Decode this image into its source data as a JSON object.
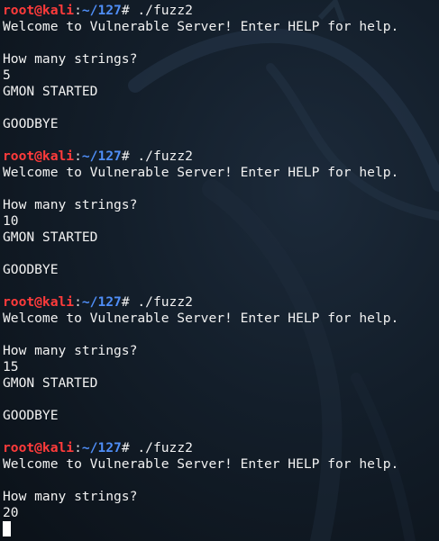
{
  "colors": {
    "user": "#ff3b3b",
    "path": "#4f8ef7",
    "text": "#f2f2f2",
    "background": "#0d141d"
  },
  "sessions": [
    {
      "prompt": {
        "user": "root@kali",
        "sep": ":",
        "path": "~/127",
        "symbol": "#",
        "command": " ./fuzz2"
      },
      "welcome": "Welcome to Vulnerable Server! Enter HELP for help.",
      "question": "How many strings?",
      "answer": "5",
      "started": "GMON STARTED",
      "goodbye": "GOODBYE"
    },
    {
      "prompt": {
        "user": "root@kali",
        "sep": ":",
        "path": "~/127",
        "symbol": "#",
        "command": " ./fuzz2"
      },
      "welcome": "Welcome to Vulnerable Server! Enter HELP for help.",
      "question": "How many strings?",
      "answer": "10",
      "started": "GMON STARTED",
      "goodbye": "GOODBYE"
    },
    {
      "prompt": {
        "user": "root@kali",
        "sep": ":",
        "path": "~/127",
        "symbol": "#",
        "command": " ./fuzz2"
      },
      "welcome": "Welcome to Vulnerable Server! Enter HELP for help.",
      "question": "How many strings?",
      "answer": "15",
      "started": "GMON STARTED",
      "goodbye": "GOODBYE"
    },
    {
      "prompt": {
        "user": "root@kali",
        "sep": ":",
        "path": "~/127",
        "symbol": "#",
        "command": " ./fuzz2"
      },
      "welcome": "Welcome to Vulnerable Server! Enter HELP for help.",
      "question": "How many strings?",
      "answer": "20"
    }
  ]
}
